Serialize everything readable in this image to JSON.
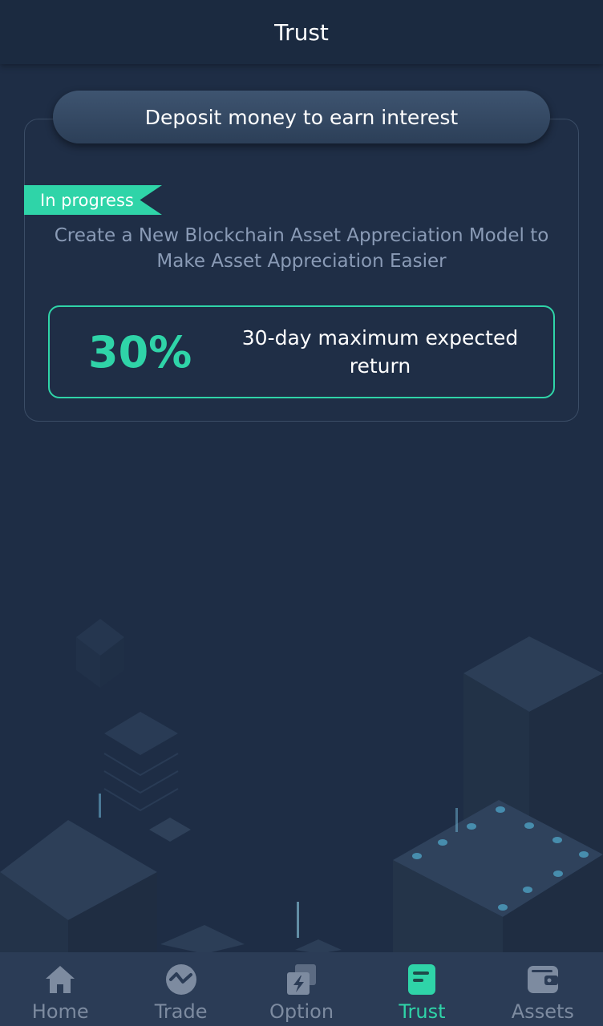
{
  "header": {
    "title": "Trust"
  },
  "card": {
    "header_label": "Deposit money to earn interest",
    "status_badge": "In progress",
    "description": "Create a New Blockchain Asset Appreciation Model to Make Asset Appreciation Easier",
    "return_value": "30%",
    "return_label": "30-day maximum expected return"
  },
  "tabs": [
    {
      "label": "Home",
      "icon": "home-icon"
    },
    {
      "label": "Trade",
      "icon": "trade-icon"
    },
    {
      "label": "Option",
      "icon": "option-icon"
    },
    {
      "label": "Trust",
      "icon": "trust-icon",
      "active": true
    },
    {
      "label": "Assets",
      "icon": "wallet-icon"
    }
  ],
  "colors": {
    "background": "#1e2d45",
    "accent": "#2fd4a8",
    "tab_inactive": "#7d8ba0",
    "tabbar": "#2b3c56"
  }
}
